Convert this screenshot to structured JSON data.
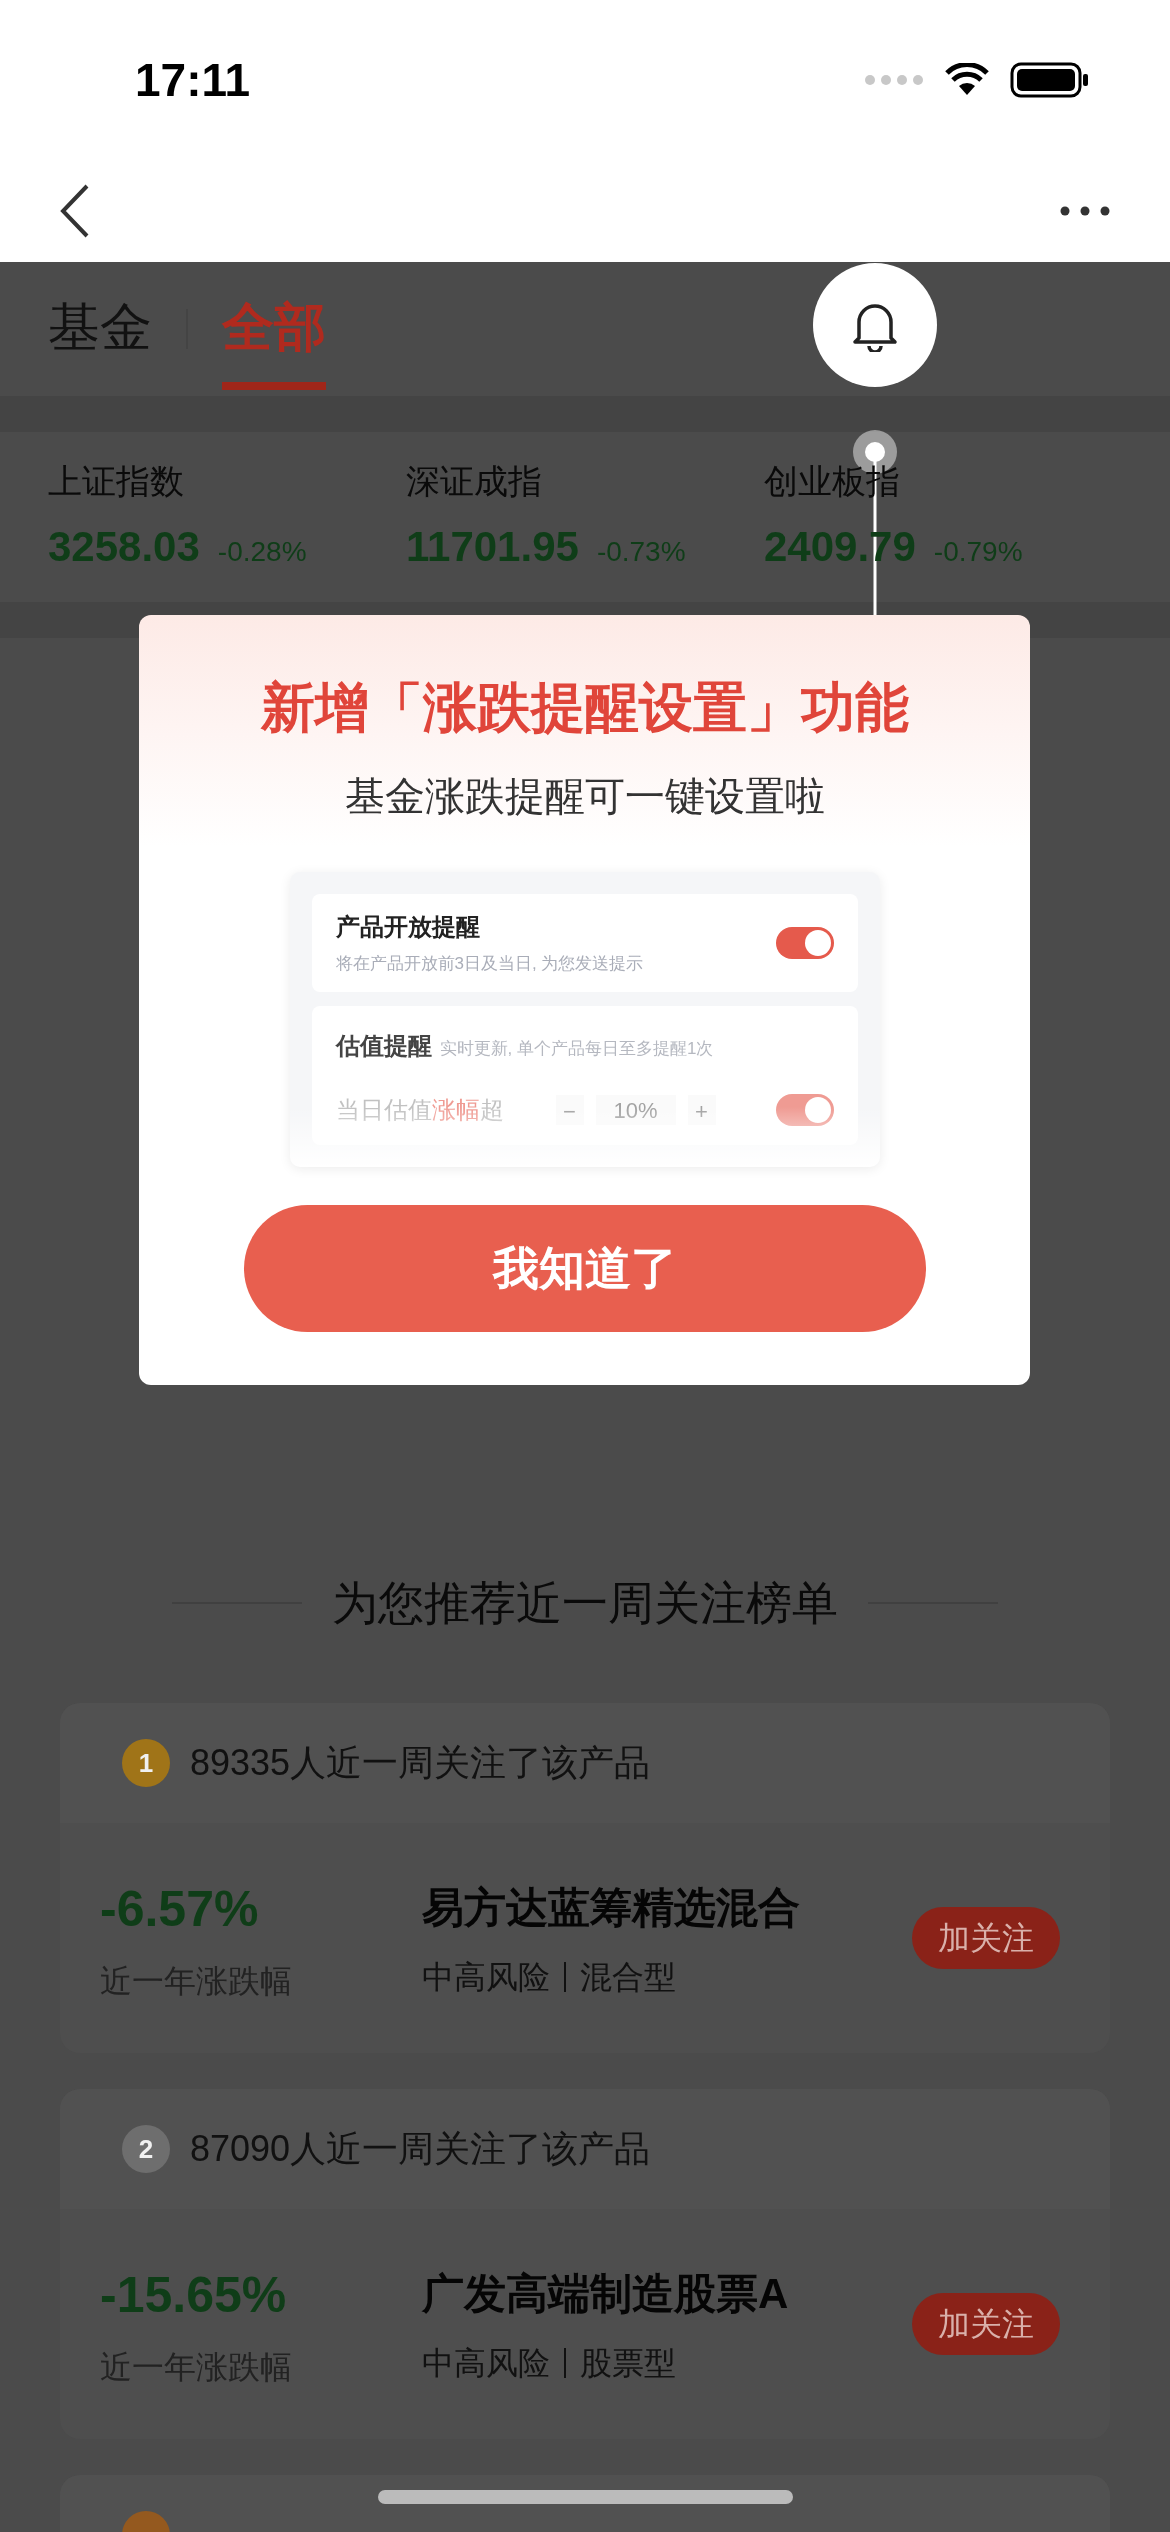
{
  "status_bar": {
    "time": "17:11"
  },
  "tabs": [
    {
      "label": "基金",
      "selected": false
    },
    {
      "label": "全部",
      "selected": true
    }
  ],
  "indices": [
    {
      "name": "上证指数",
      "value": "3258.03",
      "change": "-0.28%"
    },
    {
      "name": "深证成指",
      "value": "11701.95",
      "change": "-0.73%"
    },
    {
      "name": "创业板指",
      "value": "2409.79",
      "change": "-0.79%"
    }
  ],
  "modal": {
    "title": "新增「涨跌提醒设置」功能",
    "subtitle": "基金涨跌提醒可一键设置啦",
    "preview": [
      {
        "kind": "toggle",
        "title": "产品开放提醒",
        "desc": "将在产品开放前3日及当日, 为您发送提示",
        "on": true
      },
      {
        "kind": "stepper",
        "title": "估值提醒",
        "desc": "实时更新, 单个产品每日至多提醒1次",
        "label_start": "当日估值",
        "label_highlight": "涨幅",
        "label_end": "超",
        "minus": "−",
        "value": "10%",
        "plus": "+",
        "on": true
      }
    ],
    "button": "我知道了"
  },
  "recommend": {
    "heading": "为您推荐近一周关注榜单",
    "items": [
      {
        "medal": "1",
        "color": "#a07418",
        "followers": "89335人近一周关注了该产品",
        "change": "-6.57%",
        "change_label": "近一年涨跌幅",
        "name": "易方达蓝筹精选混合",
        "risk": "中高风险",
        "type": "混合型",
        "button": "加关注"
      },
      {
        "medal": "2",
        "color": "#6e6e6e",
        "followers": "87090人近一周关注了该产品",
        "change": "-15.65%",
        "change_label": "近一年涨跌幅",
        "name": "广发高端制造股票A",
        "risk": "中高风险",
        "type": "股票型",
        "button": "加关注"
      },
      {
        "color": "#94591f"
      }
    ]
  }
}
